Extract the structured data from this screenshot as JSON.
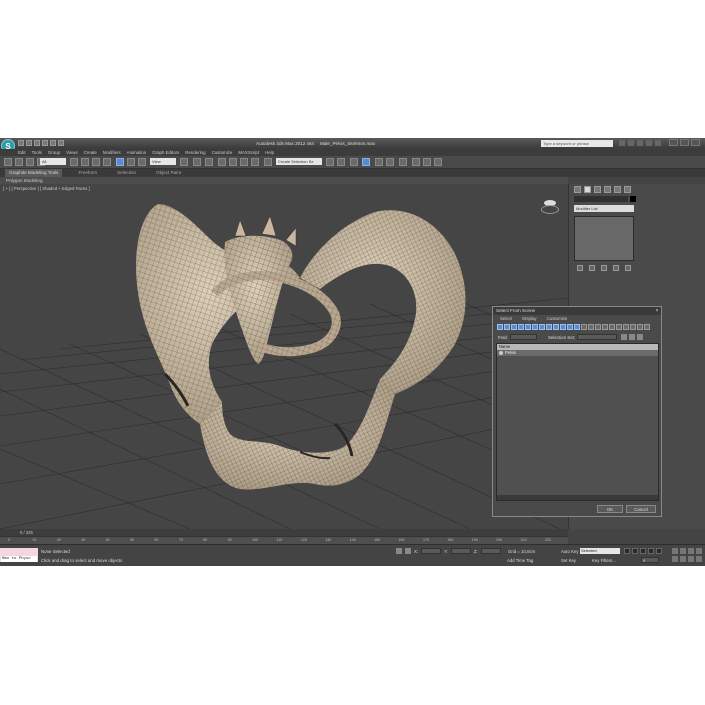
{
  "title_bar": {
    "app_title": "Autodesk 3ds Max  2012 x64",
    "file_name": "Male_Pelvis_Skeleton.max",
    "search_placeholder": "Type a keyword or phrase"
  },
  "menu": [
    "Edit",
    "Tools",
    "Group",
    "Views",
    "Create",
    "Modifiers",
    "Animation",
    "Graph Editors",
    "Rendering",
    "Customize",
    "MAXScript",
    "Help"
  ],
  "toolbar": {
    "selection_filter": "All",
    "reference_coord": "View",
    "named_selection": "Create Selection Se"
  },
  "ribbon": {
    "tabs": [
      "Graphite Modeling Tools",
      "Freeform",
      "Selection",
      "Object Paint"
    ],
    "active_tab": "Graphite Modeling Tools",
    "panel_label": "Polygon Modeling"
  },
  "viewport": {
    "label": "[ + ] [ Perspective ] [ Shaded + Edged Faces ]",
    "mesh_color": "#cdbca4",
    "wire_color": "#3a3530"
  },
  "command_panel": {
    "modifier_list": "Modifier List"
  },
  "timeline": {
    "frame_display": "0 / 225",
    "ticks": [
      "0",
      "10",
      "20",
      "30",
      "40",
      "50",
      "60",
      "70",
      "80",
      "90",
      "100",
      "110",
      "120",
      "130",
      "140",
      "150",
      "160",
      "170",
      "180",
      "190",
      "200",
      "210",
      "220"
    ]
  },
  "status": {
    "maxscript_text": "Max to Physc",
    "selection_status": "None Selected",
    "prompt": "Click and drag to select and move objects",
    "x_label": "X:",
    "y_label": "Y:",
    "z_label": "Z:",
    "grid": "Grid = 10,0cm",
    "add_time_tag": "Add Time Tag",
    "auto_key": "Auto Key",
    "selected_option": "Selected",
    "set_key": "Set Key",
    "key_filters": "Key Filters...",
    "current_frame": "0"
  },
  "dialog": {
    "title": "Select From Scene",
    "menu": [
      "Select",
      "Display",
      "Customize"
    ],
    "find_label": "Find:",
    "selection_set_label": "Selection Set:",
    "column_header": "Name",
    "items": [
      "Pelvis"
    ],
    "ok_label": "OK",
    "cancel_label": "Cancel"
  }
}
